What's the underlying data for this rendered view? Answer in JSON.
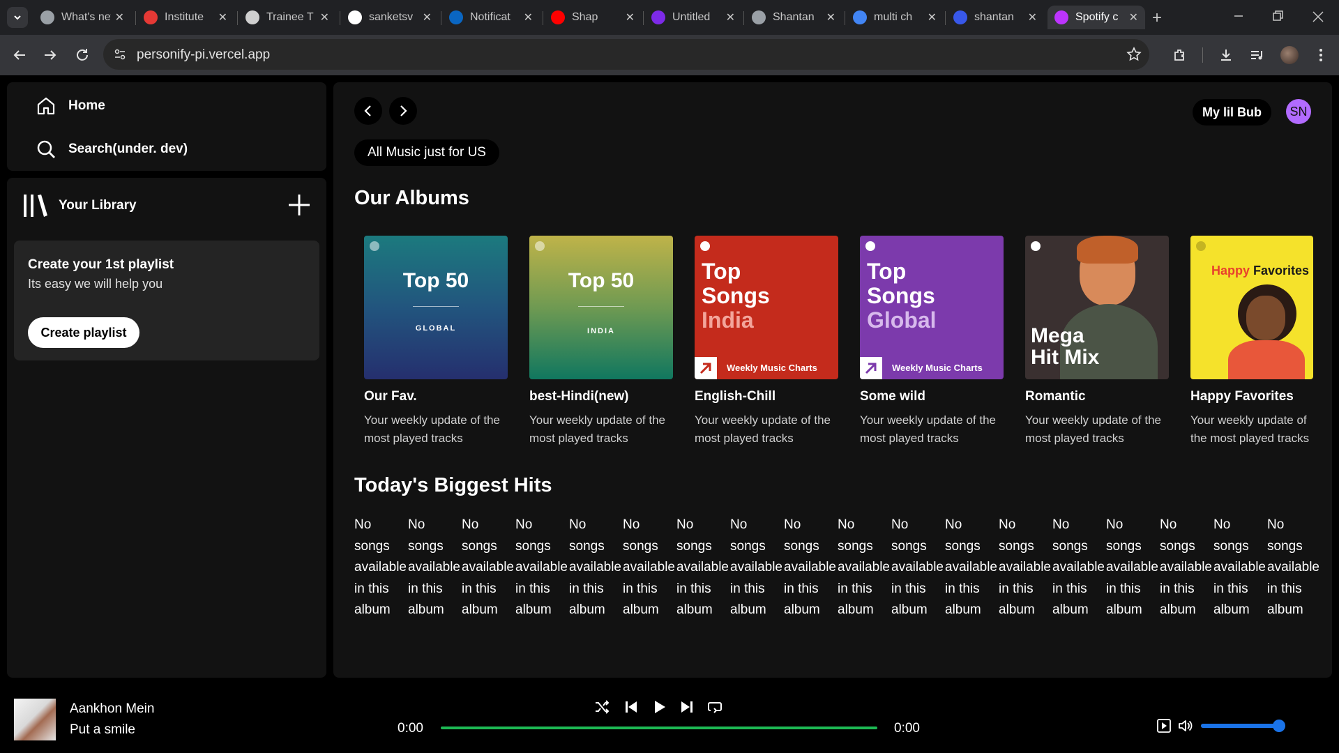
{
  "browser": {
    "tabs": [
      {
        "title": "What's new",
        "icon": "chrome-icon",
        "color": "#9aa0a6"
      },
      {
        "title": "Institute",
        "icon": "ielts-icon",
        "color": "#e53935"
      },
      {
        "title": "Trainee T",
        "icon": "openai-icon",
        "color": "#cfcfcf"
      },
      {
        "title": "sanketsv",
        "icon": "github-icon",
        "color": "#ffffff"
      },
      {
        "title": "Notificat",
        "icon": "linkedin-icon",
        "color": "#0a66c2"
      },
      {
        "title": "Shap",
        "icon": "youtube-icon",
        "color": "#ff0000"
      },
      {
        "title": "Untitled",
        "icon": "canva-icon",
        "color": "#7d2ae8"
      },
      {
        "title": "Shantan",
        "icon": "globe-icon",
        "color": "#9aa0a6"
      },
      {
        "title": "multi ch",
        "icon": "google-icon",
        "color": "#4285f4"
      },
      {
        "title": "shantan",
        "icon": "wordpress-icon",
        "color": "#3858e9"
      },
      {
        "title": "Spotify c",
        "icon": "vite-icon",
        "color": "#bd34fe"
      }
    ],
    "url": "personify-pi.vercel.app"
  },
  "sidebar": {
    "home_label": "Home",
    "search_label": "Search(under. dev)",
    "library_label": "Your Library",
    "card_title": "Create your 1st playlist",
    "card_subtitle": "Its easy we will help you",
    "create_button": "Create playlist"
  },
  "header": {
    "user_button": "My lil Bub",
    "avatar_initials": "SN",
    "filter_chip": "All Music just for US"
  },
  "albums_section": {
    "title": "Our Albums",
    "albums": [
      {
        "name": "Our Fav.",
        "desc": "Your weekly update of the most played tracks",
        "cover_title": "Top 50",
        "cover_sub": "GLOBAL"
      },
      {
        "name": "best-Hindi(new)",
        "desc": "Your weekly update of the most played tracks",
        "cover_title": "Top 50",
        "cover_sub": "INDIA"
      },
      {
        "name": "English-Chill",
        "desc": "Your weekly update of the most played tracks",
        "cover_l1": "Top",
        "cover_l2": "Songs",
        "cover_l3": "India",
        "cover_tag": "Weekly Music Charts"
      },
      {
        "name": "Some wild",
        "desc": "Your weekly update of the most played tracks",
        "cover_l1": "Top",
        "cover_l2": "Songs",
        "cover_l3": "Global",
        "cover_tag": "Weekly Music Charts"
      },
      {
        "name": "Romantic",
        "desc": "Your weekly update of the most played tracks",
        "cover_l1": "Mega",
        "cover_l2": "Hit Mix"
      },
      {
        "name": "Happy Favorites",
        "desc": "Your weekly update of the most played tracks",
        "cover_l1": "Happy",
        "cover_l2": "Favorites"
      }
    ]
  },
  "hits_section": {
    "title": "Today's Biggest Hits",
    "empty_text": "No songs available in this album",
    "empty_count": 18
  },
  "player": {
    "song_title": "Aankhon Mein",
    "song_subtitle": "Put a smile",
    "time_current": "0:00",
    "time_total": "0:00",
    "progress": 0,
    "volume": 0.95,
    "accent": "#1db954",
    "volume_color": "#1a73e8"
  }
}
